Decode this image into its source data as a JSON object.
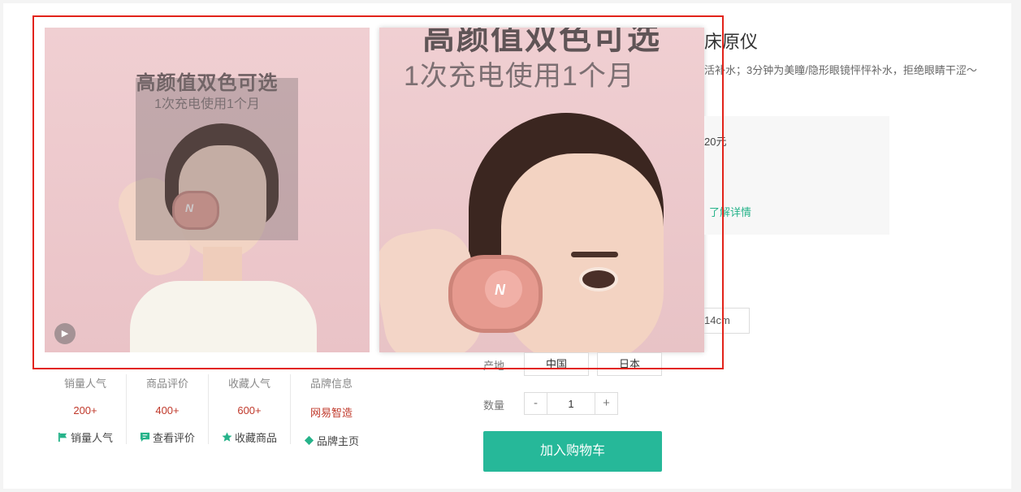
{
  "product": {
    "title": "床原仪",
    "description": "活补水；3分钟为美瞳/隐形眼镜怦怦补水，拒绝眼睛干涩～",
    "promo_fragment": "20元",
    "learn_more": "了解详情",
    "spec_fragment": "14cm"
  },
  "image": {
    "title": "高颜值双色可选",
    "subtitle": "1次充电使用1个月",
    "logo": "N"
  },
  "stats": [
    {
      "label": "销量人气",
      "value": "200+",
      "action": "销量人气",
      "icon": "flag-icon"
    },
    {
      "label": "商品评价",
      "value": "400+",
      "action": "查看评价",
      "icon": "comment-icon"
    },
    {
      "label": "收藏人气",
      "value": "600+",
      "action": "收藏商品",
      "icon": "star-icon"
    },
    {
      "label": "品牌信息",
      "value": "网易智造",
      "action": "品牌主页",
      "icon": "brand-icon"
    }
  ],
  "origin": {
    "label": "产地",
    "options": [
      "中国",
      "日本"
    ]
  },
  "quantity": {
    "label": "数量",
    "minus": "-",
    "value": "1",
    "plus": "+"
  },
  "cart_button": "加入购物车",
  "colors": {
    "accent": "#26b899",
    "price_red": "#c0392b",
    "highlight": "#e2231a"
  }
}
